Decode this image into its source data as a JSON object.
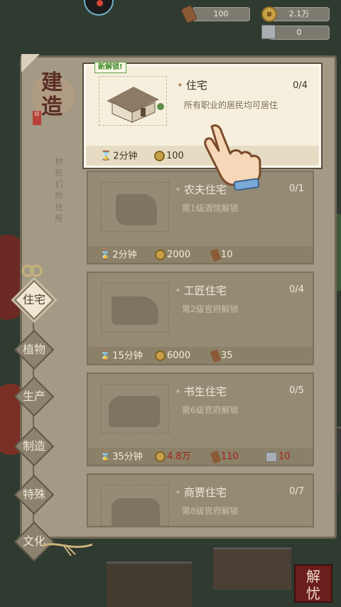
{
  "top_bar": {
    "wood": {
      "value": "100",
      "icon": "wood-log-icon"
    },
    "coins": {
      "value": "2.1万",
      "icon": "coin-icon"
    },
    "stone": {
      "value": "0",
      "icon": "stone-block-icon"
    }
  },
  "panel": {
    "title": "建造",
    "subtitle": "村民们的住所"
  },
  "tabs": [
    {
      "label": "住宅",
      "active": true
    },
    {
      "label": "植物",
      "active": false
    },
    {
      "label": "生产",
      "active": false
    },
    {
      "label": "制造",
      "active": false
    },
    {
      "label": "特殊",
      "active": false
    },
    {
      "label": "文化",
      "active": false
    }
  ],
  "buildings": [
    {
      "name": "住宅",
      "count": "0/4",
      "desc": "所有职业的居民均可居住",
      "badge": "新解锁!",
      "time": "2分钟",
      "coins": "100"
    },
    {
      "name": "农夫住宅",
      "count": "0/1",
      "desc": "需1级酒馆解锁",
      "time": "2分钟",
      "coins": "2000",
      "wood": "10"
    },
    {
      "name": "工匠住宅",
      "count": "0/4",
      "desc": "需2级官府解锁",
      "time": "15分钟",
      "coins": "6000",
      "wood": "35"
    },
    {
      "name": "书生住宅",
      "count": "0/5",
      "desc": "需6级官府解锁",
      "time": "35分钟",
      "coins": "4.8万",
      "wood": "110",
      "stone": "10"
    },
    {
      "name": "商贾住宅",
      "count": "0/7",
      "desc": "需8级官府解锁"
    }
  ],
  "corner_button": {
    "label": "解忧"
  },
  "colors": {
    "panel": "#a39a85",
    "highlight_card": "#f6efdd",
    "insufficient": "#a3231c"
  }
}
